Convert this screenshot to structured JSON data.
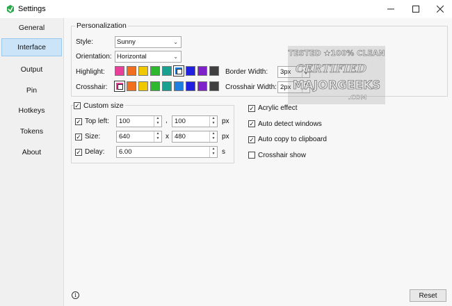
{
  "window": {
    "title": "Settings"
  },
  "sidebar": {
    "items": [
      {
        "label": "General"
      },
      {
        "label": "Interface"
      },
      {
        "label": "Output"
      },
      {
        "label": "Pin"
      },
      {
        "label": "Hotkeys"
      },
      {
        "label": "Tokens"
      },
      {
        "label": "About"
      }
    ],
    "active": "Interface"
  },
  "personalization": {
    "title": "Personalization",
    "style_label": "Style:",
    "style_value": "Sunny",
    "orientation_label": "Orientation:",
    "orientation_value": "Horizontal",
    "highlight_label": "Highlight:",
    "crosshair_label": "Crosshair:",
    "border_width_label": "Border Width:",
    "border_width_value": "3px",
    "crosshair_width_label": "Crosshair Width:",
    "crosshair_width_value": "2px",
    "colors": [
      "#e8409a",
      "#f07020",
      "#f0c800",
      "#2db82d",
      "#18a090",
      "#1e7fe0",
      "#2020e0",
      "#8020c8",
      "#404040"
    ],
    "highlight_selected_index": 5,
    "crosshair_selected_index": 0
  },
  "custom_size": {
    "title": "Custom size",
    "checked": true,
    "top_left_label": "Top left:",
    "top_left_x": "100",
    "top_left_y": "100",
    "comma": ",",
    "px1": "px",
    "size_label": "Size:",
    "size_w": "640",
    "size_h": "480",
    "x_sep": "x",
    "px2": "px",
    "delay_label": "Delay:",
    "delay_value": "6.00",
    "s_unit": "s"
  },
  "options": [
    {
      "label": "Acrylic effect",
      "checked": true
    },
    {
      "label": "Auto detect windows",
      "checked": true
    },
    {
      "label": "Auto copy to clipboard",
      "checked": true
    },
    {
      "label": "Crosshair show",
      "checked": false
    }
  ],
  "watermark": {
    "line1": "TESTED ★100% CLEAN",
    "line2": "CERTIFIED",
    "line3": "MAJORGEEKS",
    "line4": ".COM"
  },
  "footer": {
    "reset_label": "Reset",
    "info_glyph": "i"
  }
}
